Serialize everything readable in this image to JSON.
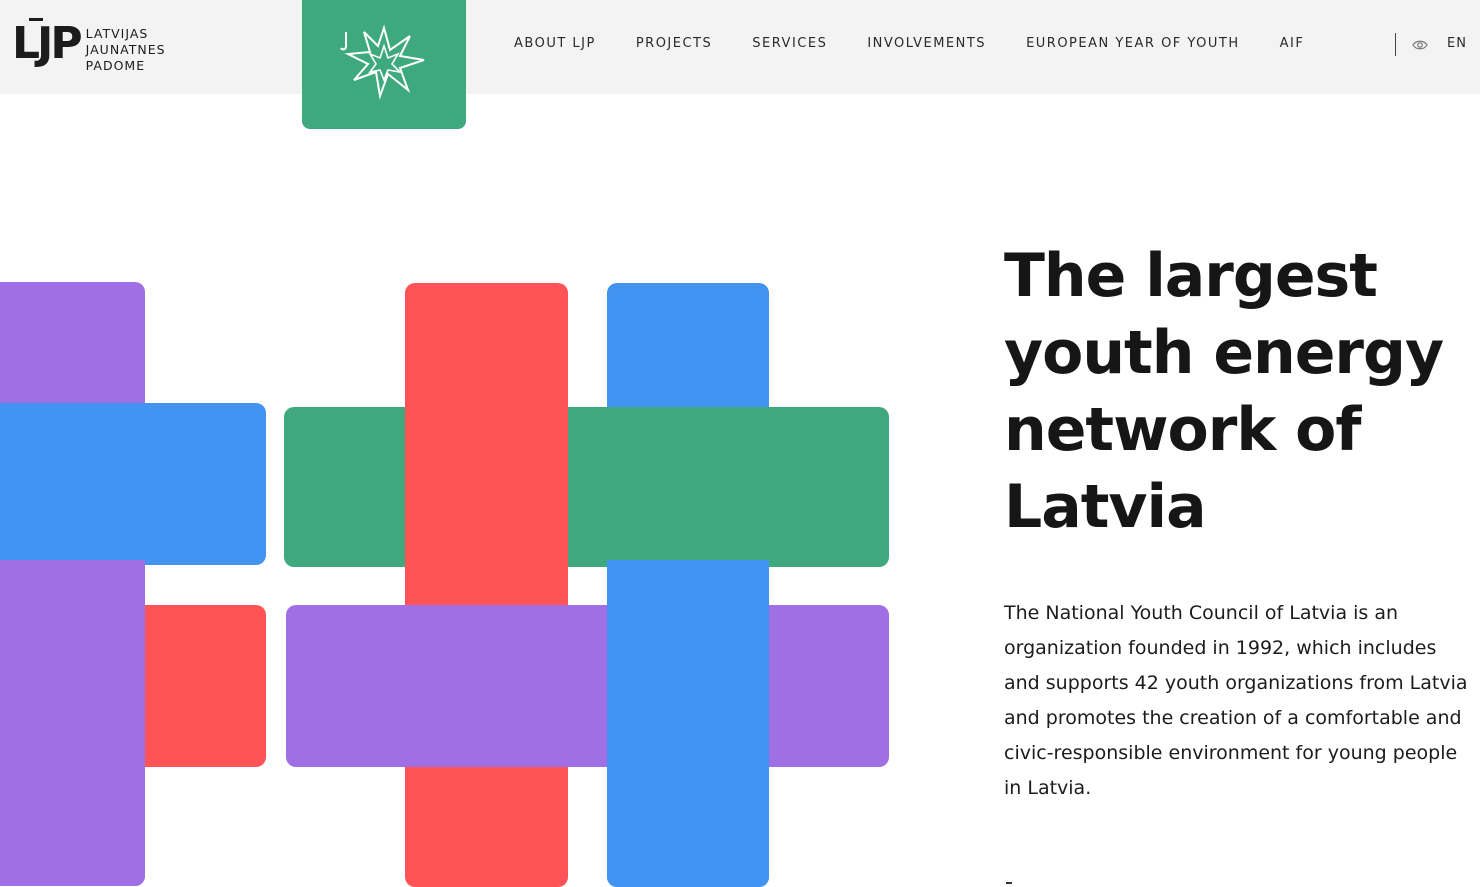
{
  "brand": {
    "logo_mark": "LJP",
    "logo_lines": [
      "LATVIJAS",
      "JAUNATNES",
      "PADOME"
    ],
    "badge_icon": "ljp-star-icon"
  },
  "nav": {
    "items": [
      {
        "label": "ABOUT LJP"
      },
      {
        "label": "PROJECTS"
      },
      {
        "label": "SERVICES"
      },
      {
        "label": "INVOLVEMENTS"
      },
      {
        "label": "EUROPEAN YEAR OF YOUTH"
      },
      {
        "label": "AIF"
      }
    ],
    "accessibility_icon": "eye-icon",
    "language": "EN"
  },
  "hero": {
    "title": "The largest youth energy network of Latvia",
    "description": "The National Youth Council of Latvia is an organization founded in 1992, which includes and supports 42 youth organizations from Latvia and promotes the creation of a comfortable and civic-responsible environment for young people in Latvia."
  },
  "colors": {
    "header_bg": "#f3f3f3",
    "green": "#3fa97d",
    "purple": "#a16fe5",
    "blue": "#4394f2",
    "red": "#ff5358",
    "text": "#161616"
  }
}
